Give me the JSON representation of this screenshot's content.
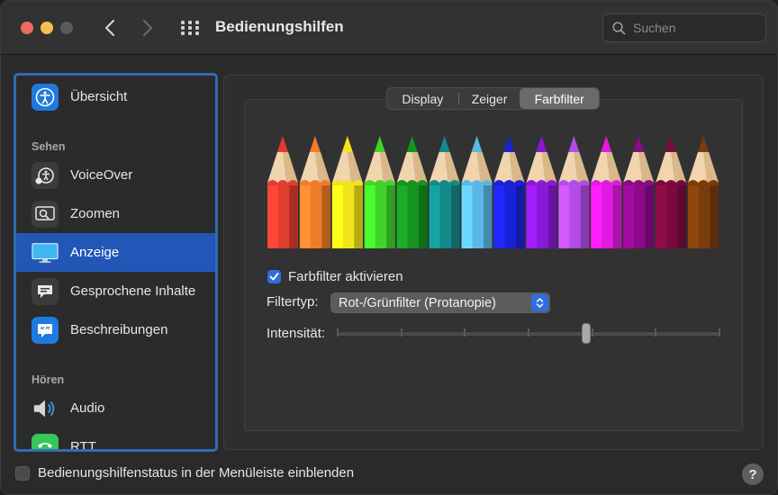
{
  "window": {
    "title": "Bedienungshilfen",
    "search_placeholder": "Suchen"
  },
  "sidebar": {
    "items": [
      {
        "label": "Übersicht",
        "icon": "accessibility-icon"
      },
      {
        "label": "VoiceOver",
        "icon": "voiceover-icon"
      },
      {
        "label": "Zoomen",
        "icon": "zoom-icon"
      },
      {
        "label": "Anzeige",
        "icon": "display-icon",
        "selected": true
      },
      {
        "label": "Gesprochene Inhalte",
        "icon": "speech-bubble-icon"
      },
      {
        "label": "Beschreibungen",
        "icon": "descriptions-icon"
      },
      {
        "label": "Audio",
        "icon": "speaker-icon"
      },
      {
        "label": "RTT",
        "icon": "rtt-phone-icon"
      }
    ],
    "headers": {
      "sehen": "Sehen",
      "hoeren": "Hören"
    }
  },
  "tabs": [
    {
      "label": "Display"
    },
    {
      "label": "Zeiger"
    },
    {
      "label": "Farbfilter",
      "selected": true
    }
  ],
  "pencil_colors": [
    "#e23b2f",
    "#f07c2a",
    "#f2e418",
    "#3fd42a",
    "#17931f",
    "#138a8a",
    "#5ab8e6",
    "#1a22d8",
    "#8a18d8",
    "#b44ce8",
    "#e21ae0",
    "#8a0a8a",
    "#7a0a3e",
    "#7a3c0a"
  ],
  "color_filter": {
    "enable_label": "Farbfilter aktivieren",
    "enabled": true,
    "filter_type_label": "Filtertyp:",
    "filter_type_value": "Rot-/Grünfilter (Protanopie)",
    "intensity_label": "Intensität:",
    "intensity_fraction": 0.65,
    "intensity_ticks": 7
  },
  "footer": {
    "status_label": "Bedienungshilfenstatus in der Menüleiste einblenden",
    "help": "?"
  },
  "colors": {
    "accent": "#2f6ee0",
    "selection": "#2257b8"
  }
}
